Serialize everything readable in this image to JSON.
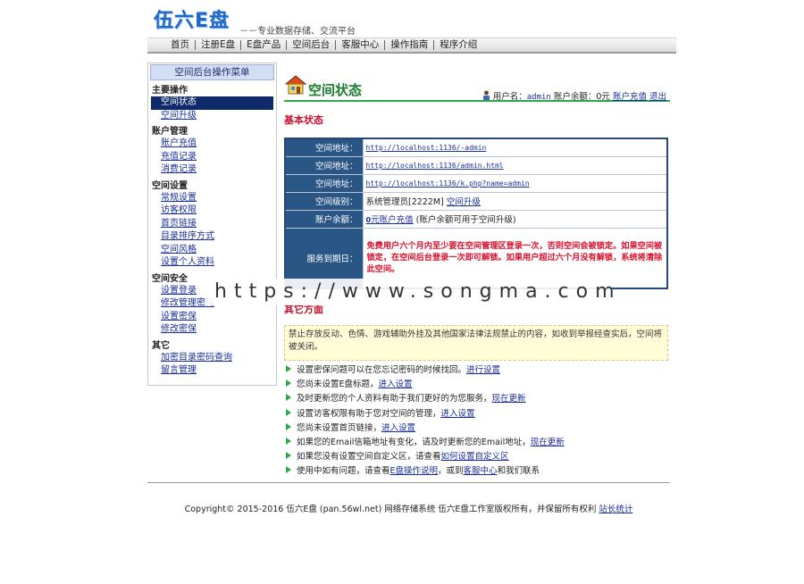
{
  "header": {
    "logo_text": "伍六E盘",
    "slogan": "－－专业数据存储、交流平台"
  },
  "nav": [
    "首页",
    "注册E盘",
    "E盘产品",
    "空间后台",
    "客服中心",
    "操作指南",
    "程序介绍"
  ],
  "sidebar": {
    "title": "空间后台操作菜单",
    "groups": [
      {
        "label": "主要操作",
        "items": [
          "空间状态",
          "空间升级"
        ]
      },
      {
        "label": "账户管理",
        "items": [
          "账户充值",
          "充值记录",
          "消费记录"
        ]
      },
      {
        "label": "空间设置",
        "items": [
          "常规设置",
          "访客权限",
          "首页链接",
          "目录排序方式",
          "空间风格",
          "设置个人资料"
        ]
      },
      {
        "label": "空间安全",
        "items": [
          "设置登录",
          "修改管理密码",
          "设置密保",
          "修改密保"
        ]
      },
      {
        "label": "其它",
        "items": [
          "加密目录密码查询",
          "留言管理"
        ]
      }
    ],
    "active_item": "空间状态"
  },
  "main": {
    "title": "空间状态",
    "user_label": "用户名：",
    "username": "admin",
    "balance_text": "账户余额：0元",
    "recharge_link": "账户充值",
    "logout_link": "退出",
    "section_basic": "基本状态",
    "rows": {
      "addr1_label": "空间地址：",
      "addr1": "http://localhost:1136/-admin",
      "addr2_label": "空间地址：",
      "addr2": "http://localhost:1136/admin.html",
      "addr3_label": "空间地址：",
      "addr3": "http://localhost:1136/k.php?name=admin",
      "level_label": "空间级别：",
      "level": "系统管理员[2222M]",
      "level_link": "空间升级",
      "balance_label": "账户余额：",
      "balance_zero": "0",
      "balance_link": "元账户充值",
      "balance_note": "(账户余额可用于空间升级)",
      "expire_label": "服务到期日：",
      "expire_warning": "免费用户六个月内至少要在空间管理区登录一次，否则空间会被锁定。如果空间被锁定，在空间后台登录一次即可解锁。如果用户超过六个月没有解锁，系统将清除此空间。"
    },
    "section_other": "其它方面",
    "notice": "禁止存放反动、色情、游戏辅助外挂及其他国家法律法规禁止的内容，如收到举报经查实后，空间将被关闭。",
    "tips": [
      {
        "text": "设置密保问题可以在您忘记密码的时候找回。",
        "link": "进行设置",
        "after": ""
      },
      {
        "text": "您尚未设置E盘标题，",
        "link": "进入设置",
        "after": ""
      },
      {
        "text": "及时更新您的个人资料有助于我们更好的为您服务，",
        "link": "现在更新",
        "after": ""
      },
      {
        "text": "设置访客权限有助于您对空间的管理，",
        "link": "进入设置",
        "after": ""
      },
      {
        "text": "您尚未设置首页链接，",
        "link": "进入设置",
        "after": ""
      },
      {
        "text": "如果您的Email信箱地址有变化，请及时更新您的Email地址，",
        "link": "现在更新",
        "after": ""
      },
      {
        "text": "如果您没有设置空间自定义区，请查看",
        "link": "如何设置自定义区",
        "after": ""
      },
      {
        "text": "使用中如有问题，请查看",
        "link": "E盘操作说明",
        "after": "，或到",
        "link2": "客服中心",
        "after2": "和我们联系"
      }
    ]
  },
  "footer": {
    "text": "Copyright© 2015-2016 伍六E盘 (pan.56wl.net) 网络存储系统 伍六E盘工作室版权所有，并保留所有权利",
    "link": "站长统计"
  },
  "watermark": "https://www.songma.com",
  "colors": {
    "accent_green": "#2aa84a",
    "title_red": "#c8102e",
    "label_bg": "#2a5685",
    "warn_red": "#d8122e"
  }
}
